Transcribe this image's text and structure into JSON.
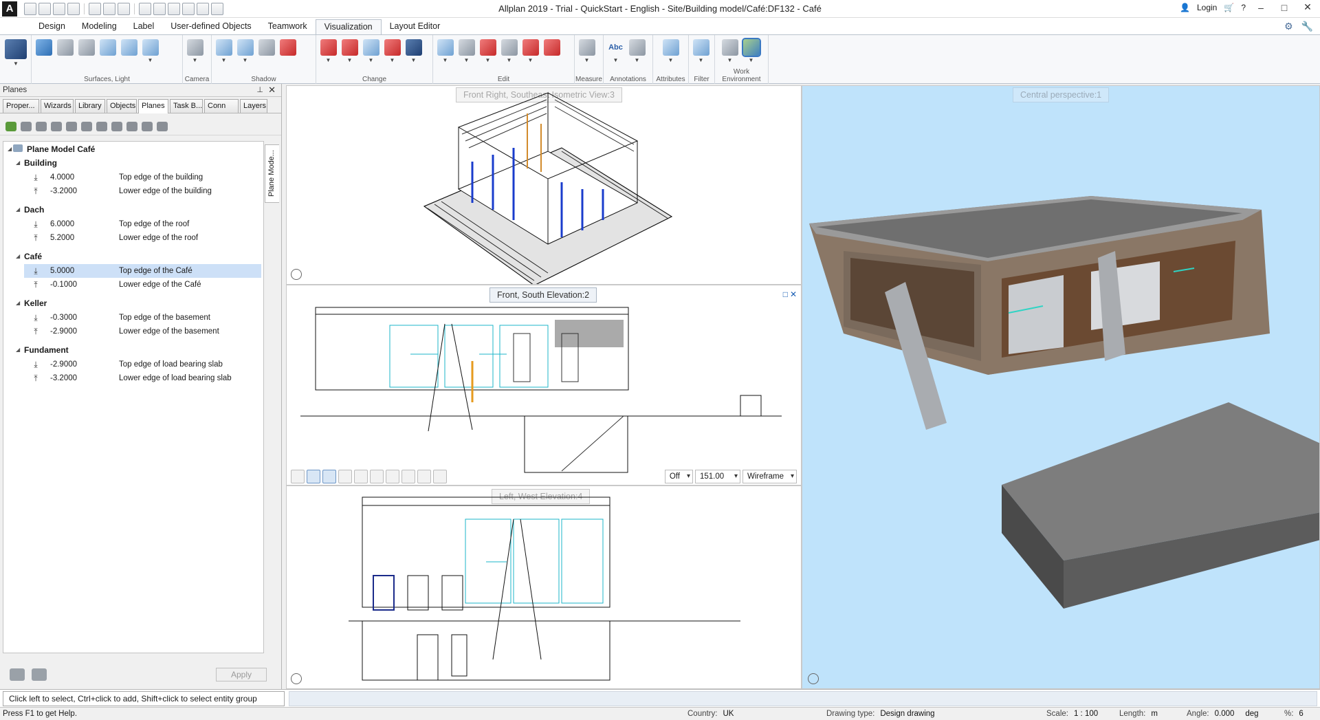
{
  "window": {
    "title": "Allplan 2019 - Trial - QuickStart - English - Site/Building model/Café:DF132 - Café",
    "logo": "A",
    "login": "Login",
    "help": "?",
    "controls": [
      "–",
      "□",
      "✕"
    ]
  },
  "ribbon": {
    "tabs": [
      {
        "label": "Design"
      },
      {
        "label": "Modeling"
      },
      {
        "label": "Label"
      },
      {
        "label": "User-defined Objects"
      },
      {
        "label": "Teamwork"
      },
      {
        "label": "Visualization",
        "active": true
      },
      {
        "label": "Layout Editor"
      }
    ],
    "groups": [
      {
        "label": "Surfaces, Light"
      },
      {
        "label": "Camera"
      },
      {
        "label": "Shadow"
      },
      {
        "label": "Change"
      },
      {
        "label": "Edit"
      },
      {
        "label": "Measure"
      },
      {
        "label": "Annotations"
      },
      {
        "label": "Attributes"
      },
      {
        "label": "Filter"
      },
      {
        "label": "Work Environment"
      }
    ],
    "annotation_text": "Abc"
  },
  "palette": {
    "title": "Planes",
    "pin": "📌",
    "close": "✕",
    "tabs": [
      {
        "label": "Proper..."
      },
      {
        "label": "Wizards"
      },
      {
        "label": "Library"
      },
      {
        "label": "Objects"
      },
      {
        "label": "Planes",
        "active": true
      },
      {
        "label": "Task B..."
      },
      {
        "label": "Conn"
      },
      {
        "label": "Layers"
      }
    ],
    "side_tab": "Plane Mode...",
    "root": "Plane Model Café",
    "groups": [
      {
        "name": "Building",
        "rows": [
          {
            "value": "4.0000",
            "desc": "Top edge of the building",
            "kind": "top"
          },
          {
            "value": "-3.2000",
            "desc": "Lower edge of the building",
            "kind": "bottom"
          }
        ]
      },
      {
        "name": "Dach",
        "rows": [
          {
            "value": "6.0000",
            "desc": "Top edge of the roof",
            "kind": "top"
          },
          {
            "value": "5.2000",
            "desc": "Lower edge of the roof",
            "kind": "bottom"
          }
        ]
      },
      {
        "name": "Café",
        "rows": [
          {
            "value": "5.0000",
            "desc": "Top edge of the Café",
            "kind": "top",
            "selected": true
          },
          {
            "value": "-0.1000",
            "desc": "Lower edge of the Café",
            "kind": "bottom"
          }
        ]
      },
      {
        "name": "Keller",
        "rows": [
          {
            "value": "-0.3000",
            "desc": "Top edge of the basement",
            "kind": "top"
          },
          {
            "value": "-2.9000",
            "desc": "Lower edge of the basement",
            "kind": "bottom"
          }
        ]
      },
      {
        "name": "Fundament",
        "rows": [
          {
            "value": "-2.9000",
            "desc": "Top edge of load bearing slab",
            "kind": "top"
          },
          {
            "value": "-3.2000",
            "desc": "Lower edge of load bearing slab",
            "kind": "bottom"
          }
        ]
      }
    ],
    "apply_label": "Apply"
  },
  "viewports": {
    "iso": {
      "title": "Front Right, Southeast Isometric View:3"
    },
    "south": {
      "title": "Front, South Elevation:2",
      "restore": "□",
      "close": "✕",
      "toolbar": {
        "shadow": "Off",
        "scale": "151.00",
        "mode": "Wireframe"
      }
    },
    "west": {
      "title": "Left, West Elevation:4"
    },
    "perspective": {
      "title": "Central perspective:1"
    }
  },
  "command_prompt": "Click left to select, Ctrl+click to add, Shift+click to select entity group",
  "status": {
    "help": "Press F1 to get Help.",
    "country_label": "Country:",
    "country": "UK",
    "drawing_type_label": "Drawing type:",
    "drawing_type": "Design drawing",
    "scale_label": "Scale:",
    "scale": "1 : 100",
    "length_label": "Length:",
    "length": "m",
    "angle_label": "Angle:",
    "angle": "0.000",
    "angle_unit": "deg",
    "percent_label": "%:",
    "percent": "6"
  },
  "colors": {
    "perspective_sky": "#bfe3fb",
    "selection": "#cde0f7",
    "accent": "#2e6fb5"
  }
}
